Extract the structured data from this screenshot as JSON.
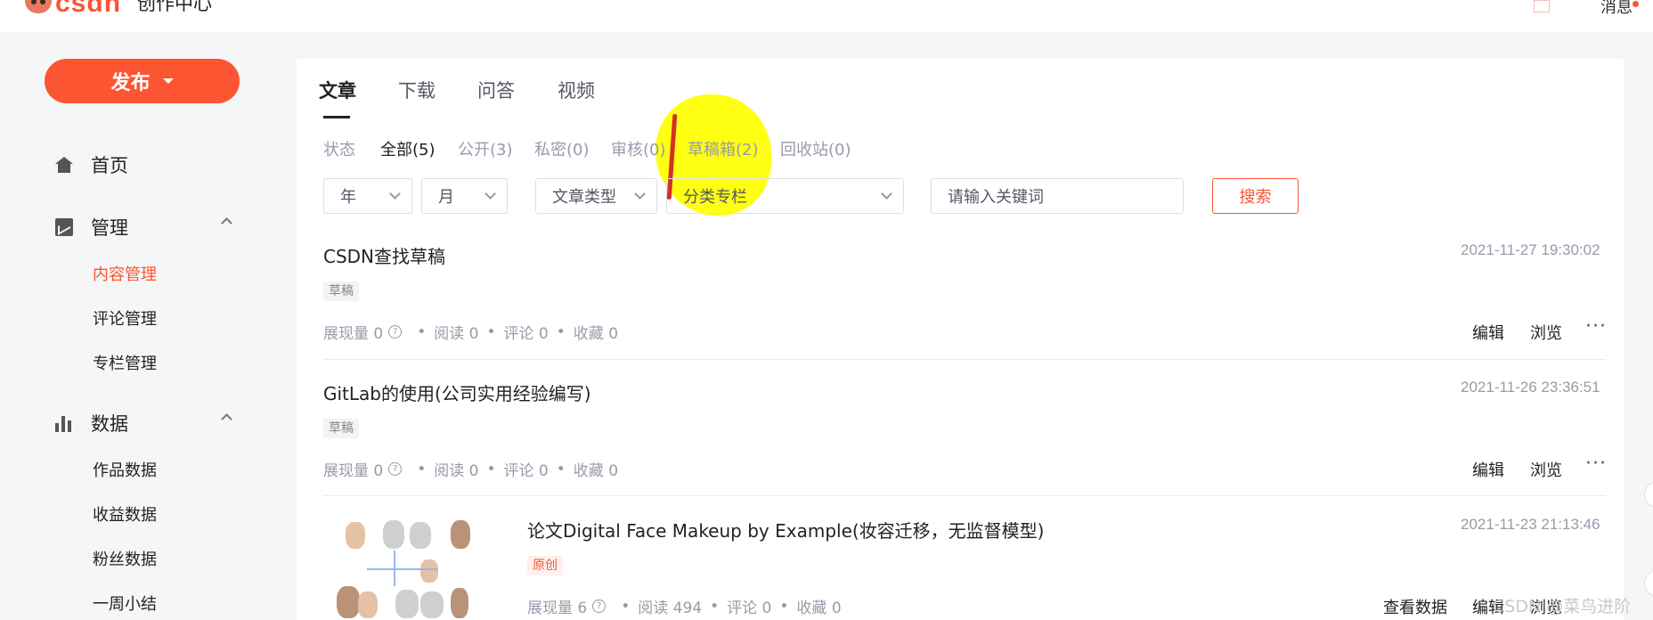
{
  "header": {
    "logo_text": "CSDN",
    "subtitle": "创作中心",
    "messages_label": "消息"
  },
  "sidebar": {
    "publish_label": "发布",
    "home_label": "首页",
    "manage": {
      "label": "管理",
      "items": [
        "内容管理",
        "评论管理",
        "专栏管理"
      ],
      "active": "内容管理"
    },
    "data": {
      "label": "数据",
      "items": [
        "作品数据",
        "收益数据",
        "粉丝数据",
        "一周小结"
      ]
    }
  },
  "tabs": [
    "文章",
    "下载",
    "问答",
    "视频"
  ],
  "active_tab": "文章",
  "filters": {
    "label": "状态",
    "items": [
      "全部(5)",
      "公开(3)",
      "私密(0)",
      "审核(0)",
      "草稿箱(2)",
      "回收站(0)"
    ],
    "active": "全部(5)"
  },
  "selects": {
    "year": "年",
    "month": "月",
    "type": "文章类型",
    "column": "分类专栏"
  },
  "search": {
    "placeholder": "请输入关键词",
    "button": "搜索"
  },
  "articles": [
    {
      "title": "CSDN查找草稿",
      "date": "2021-11-27 19:30:02",
      "tag": "草稿",
      "stats": {
        "impressions": "展现量 0",
        "reads": "阅读 0",
        "comments": "评论 0",
        "favorites": "收藏 0"
      },
      "actions": [
        "编辑",
        "浏览"
      ]
    },
    {
      "title": "GitLab的使用(公司实用经验编写)",
      "date": "2021-11-26 23:36:51",
      "tag": "草稿",
      "stats": {
        "impressions": "展现量 0",
        "reads": "阅读 0",
        "comments": "评论 0",
        "favorites": "收藏 0"
      },
      "actions": [
        "编辑",
        "浏览"
      ]
    },
    {
      "title": "论文Digital Face Makeup by Example(妆容迁移，无监督模型)",
      "date": "2021-11-23 21:13:46",
      "tag": "原创",
      "stats": {
        "impressions": "展现量 6",
        "reads": "阅读 494",
        "comments": "评论 0",
        "favorites": "收藏 0"
      },
      "actions": [
        "查看数据",
        "编辑",
        "浏览"
      ]
    }
  ],
  "more_label": "···",
  "watermark": "CSDN @菜鸟进阶中...",
  "colors": {
    "brand": "#fc5531",
    "highlight": "#ffff00"
  }
}
